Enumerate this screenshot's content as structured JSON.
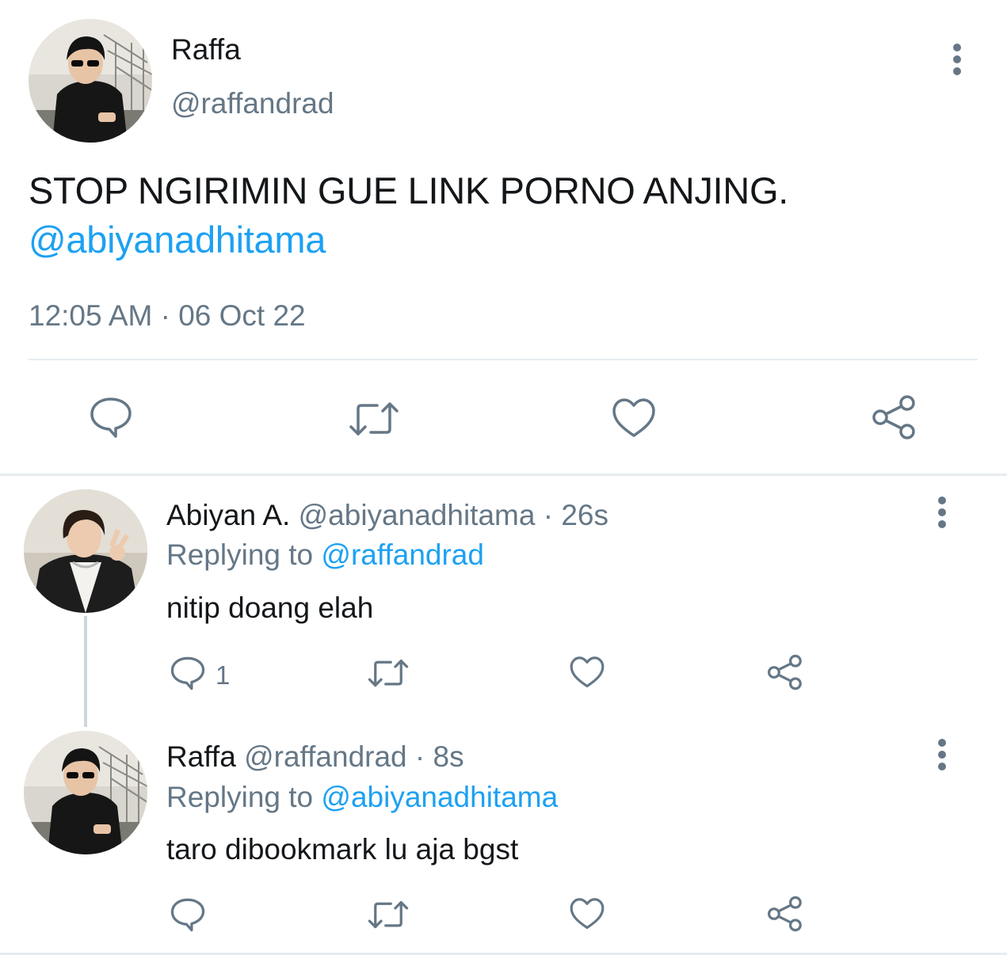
{
  "main_tweet": {
    "name": "Raffa",
    "handle": "@raffandrad",
    "text": "STOP NGIRIMIN GUE LINK PORNO ANJING.",
    "mention": "@abiyanadhitama",
    "timestamp": "12:05 AM · 06 Oct 22",
    "actions": [
      "reply-icon",
      "retweet-icon",
      "like-icon",
      "share-icon"
    ]
  },
  "replies": [
    {
      "name": "Abiyan A.",
      "handle": "@abiyanadhitama",
      "separator": " · ",
      "time": "26s",
      "replying_label": "Replying to",
      "replying_to": "@raffandrad",
      "text": "nitip doang elah",
      "reply_count": "1"
    },
    {
      "name": "Raffa",
      "handle": "@raffandrad",
      "separator": " · ",
      "time": "8s",
      "replying_label": "Replying to",
      "replying_to": "@abiyanadhitama",
      "text": "taro dibookmark lu aja bgst",
      "reply_count": ""
    }
  ],
  "colors": {
    "accent": "#1da1f2",
    "secondary_text": "#657786",
    "primary_text": "#14171a",
    "divider": "#e6ecf0"
  }
}
